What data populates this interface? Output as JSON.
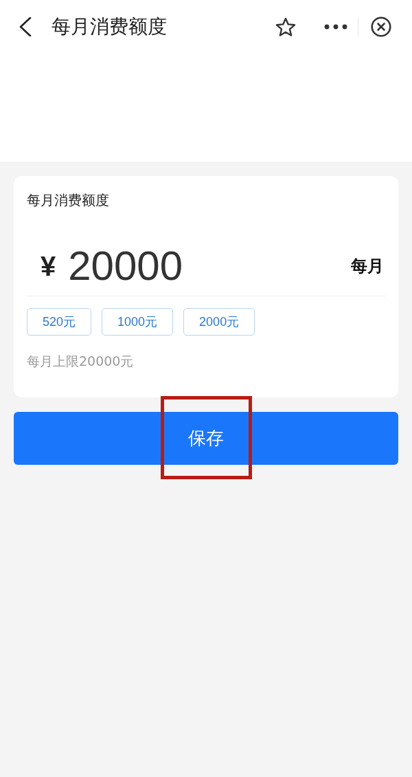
{
  "header": {
    "title": "每月消费额度"
  },
  "card": {
    "title": "每月消费额度",
    "currency": "¥",
    "amount": "20000",
    "period": "每月",
    "presets": [
      {
        "label": "520元",
        "selected": false
      },
      {
        "label": "1000元",
        "selected": false
      },
      {
        "label": "2000元",
        "selected": false
      }
    ],
    "hint": "每月上限20000元"
  },
  "save_button": {
    "label": "保存"
  },
  "annotation": {
    "kind": "highlight-box"
  }
}
